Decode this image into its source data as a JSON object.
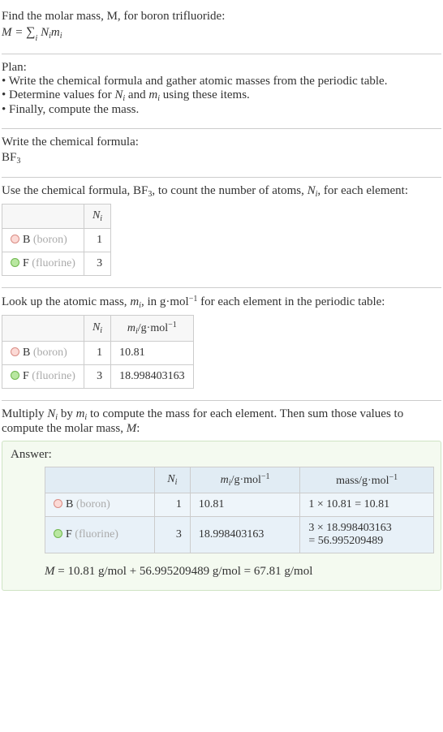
{
  "intro": {
    "line1": "Find the molar mass, M, for boron trifluoride:",
    "formula_M": "M",
    "formula_eq": " = ",
    "sigma_under": "i",
    "Nimi": "N",
    "Nimi_sub_i": "i",
    "Nimi_m": "m",
    "Nimi_m_sub_i": "i"
  },
  "plan": {
    "heading": "Plan:",
    "b1": "• Write the chemical formula and gather atomic masses from the periodic table.",
    "b2_a": "• Determine values for ",
    "b2_b": " and ",
    "b2_c": " using these items.",
    "b3": "• Finally, compute the mass."
  },
  "chem_formula": {
    "heading": "Write the chemical formula:",
    "formula_base": "BF",
    "formula_sub": "3"
  },
  "count_atoms": {
    "text_a": "Use the chemical formula, BF",
    "text_sub": "3",
    "text_b": ", to count the number of atoms, ",
    "text_c": ", for each element:",
    "header_Ni_N": "N",
    "header_Ni_i": "i",
    "r1_elem_letter": "B",
    "r1_elem_name": " (boron)",
    "r1_n": "1",
    "r2_elem_letter": "F",
    "r2_elem_name": " (fluorine)",
    "r2_n": "3"
  },
  "atomic_mass": {
    "text_a": "Look up the atomic mass, ",
    "text_b": ", in g·mol",
    "text_sup": "−1",
    "text_c": " for each element in the periodic table:",
    "header_Ni_N": "N",
    "header_Ni_i": "i",
    "header_mi_m": "m",
    "header_mi_i": "i",
    "header_mi_unit_a": "/g·mol",
    "header_mi_unit_sup": "−1",
    "r1_elem_letter": "B",
    "r1_elem_name": " (boron)",
    "r1_n": "1",
    "r1_m": "10.81",
    "r2_elem_letter": "F",
    "r2_elem_name": " (fluorine)",
    "r2_n": "3",
    "r2_m": "18.998403163"
  },
  "multiply": {
    "text_a": "Multiply ",
    "text_b": " by ",
    "text_c": " to compute the mass for each element. Then sum those values to compute the molar mass, ",
    "text_d": ":"
  },
  "answer": {
    "label": "Answer:",
    "header_Ni_N": "N",
    "header_Ni_i": "i",
    "header_mi_m": "m",
    "header_mi_i": "i",
    "header_mi_unit_a": "/g·mol",
    "header_mi_unit_sup": "−1",
    "header_mass_a": "mass/g·mol",
    "header_mass_sup": "−1",
    "r1_elem_letter": "B",
    "r1_elem_name": " (boron)",
    "r1_n": "1",
    "r1_m": "10.81",
    "r1_mass": "1 × 10.81 = 10.81",
    "r2_elem_letter": "F",
    "r2_elem_name": " (fluorine)",
    "r2_n": "3",
    "r2_m": "18.998403163",
    "r2_mass_line1": "3 × 18.998403163",
    "r2_mass_line2": "= 56.995209489",
    "final_M": "M",
    "final_text": " = 10.81 g/mol + 56.995209489 g/mol = 67.81 g/mol"
  },
  "chart_data": {
    "type": "table",
    "title": "Molar mass calculation for boron trifluoride (BF3)",
    "series": [
      {
        "element": "B (boron)",
        "N_i": 1,
        "m_i_g_per_mol": 10.81,
        "mass_g_per_mol": 10.81
      },
      {
        "element": "F (fluorine)",
        "N_i": 3,
        "m_i_g_per_mol": 18.998403163,
        "mass_g_per_mol": 56.995209489
      }
    ],
    "total_molar_mass_g_per_mol": 67.81
  }
}
